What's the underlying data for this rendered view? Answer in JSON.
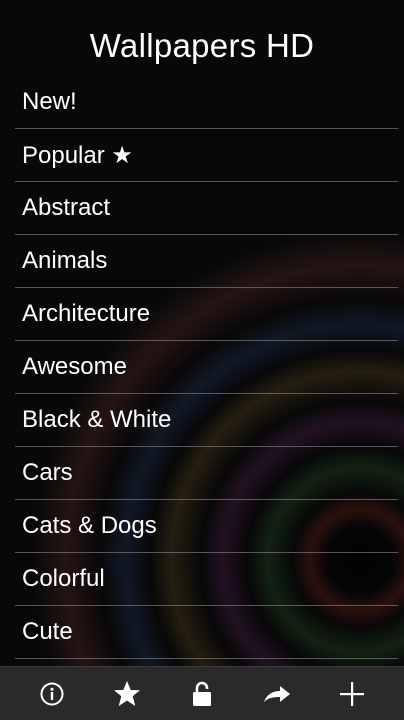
{
  "header": {
    "title": "Wallpapers HD"
  },
  "categories": [
    {
      "label": "New!"
    },
    {
      "label": "Popular ★"
    },
    {
      "label": "Abstract"
    },
    {
      "label": "Animals"
    },
    {
      "label": "Architecture"
    },
    {
      "label": "Awesome"
    },
    {
      "label": "Black & White"
    },
    {
      "label": "Cars"
    },
    {
      "label": "Cats & Dogs"
    },
    {
      "label": "Colorful"
    },
    {
      "label": "Cute"
    }
  ],
  "toolbar": {
    "items": [
      {
        "icon": "info-icon"
      },
      {
        "icon": "star-icon"
      },
      {
        "icon": "lock-icon"
      },
      {
        "icon": "share-arrow-icon"
      },
      {
        "icon": "plus-icon"
      }
    ]
  },
  "colors": {
    "text": "#ffffff",
    "toolbar_bg": "#2a2a2b",
    "separator": "#969696"
  }
}
